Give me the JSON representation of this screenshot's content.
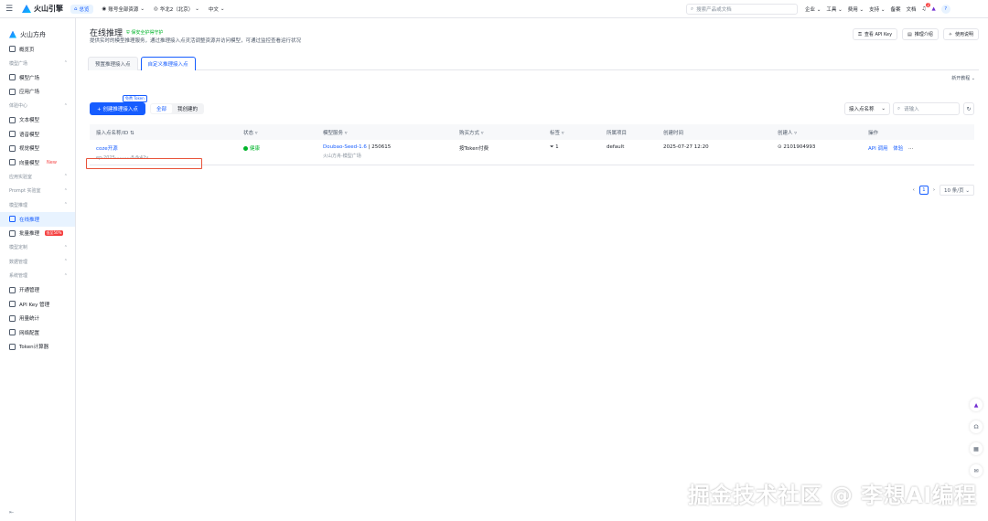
{
  "topbar": {
    "logo_text": "火山引擎",
    "home_label": "总览",
    "account_scope": "账号全部资源",
    "region": "华北2（北京）",
    "language": "中文",
    "search_placeholder": "搜索产品或文档",
    "links": [
      "企业",
      "工具",
      "费用",
      "支持",
      "备案",
      "文档"
    ],
    "notification_count": "2",
    "user_initial": "?"
  },
  "sidebar": {
    "brand": "火山方舟",
    "items": [
      {
        "type": "item",
        "label": "概览页",
        "icon": "overview-icon"
      },
      {
        "type": "group",
        "label": "模型广场"
      },
      {
        "type": "item",
        "label": "模型广场",
        "icon": "model-square-icon"
      },
      {
        "type": "item",
        "label": "应用广场",
        "icon": "app-square-icon"
      },
      {
        "type": "group",
        "label": "体验中心"
      },
      {
        "type": "item",
        "label": "文本模型",
        "icon": "text-model-icon"
      },
      {
        "type": "item",
        "label": "语音模型",
        "icon": "voice-model-icon"
      },
      {
        "type": "item",
        "label": "视觉模型",
        "icon": "vision-model-icon"
      },
      {
        "type": "item",
        "label": "向量模型",
        "icon": "vector-model-icon",
        "tag": "New"
      },
      {
        "type": "group",
        "label": "应用实验室"
      },
      {
        "type": "group",
        "label": "Prompt 实验室"
      },
      {
        "type": "group",
        "label": "模型推理"
      },
      {
        "type": "item",
        "label": "在线推理",
        "icon": "online-inference-icon",
        "active": true
      },
      {
        "type": "item",
        "label": "批量推理",
        "icon": "batch-inference-icon",
        "tag": "低至50%"
      },
      {
        "type": "group",
        "label": "模型定制"
      },
      {
        "type": "group",
        "label": "数据管理"
      },
      {
        "type": "group",
        "label": "系统管理"
      },
      {
        "type": "item",
        "label": "开通管理",
        "icon": "activation-icon"
      },
      {
        "type": "item",
        "label": "API Key 管理",
        "icon": "key-icon"
      },
      {
        "type": "item",
        "label": "用量统计",
        "icon": "usage-icon"
      },
      {
        "type": "item",
        "label": "网络配置",
        "icon": "network-icon"
      },
      {
        "type": "item",
        "label": "Token计算器",
        "icon": "calculator-icon"
      }
    ]
  },
  "page": {
    "title": "在线推理",
    "secure_badge": "保安全护得守护",
    "description": "提供实时的模型推理服务，通过推理接入点灵活调整资源并访问模型，可通过监控查看运行状况",
    "top_buttons": [
      "查看 API Key",
      "推理介绍",
      "使用说明"
    ],
    "tabs": [
      "预置推理接入点",
      "自定义推理接入点"
    ],
    "active_tab": 1,
    "new_version": "新开教程"
  },
  "toolbar": {
    "free_tag": "免费 Token",
    "create_label": "+ 创建推理接入点",
    "segments": [
      "全部",
      "我创建的"
    ],
    "filter_select": "接入点名称",
    "filter_placeholder": "请输入"
  },
  "table": {
    "columns": [
      "接入点名称/ID",
      "状态",
      "模型服务",
      "购买方式",
      "标签",
      "所属项目",
      "创建时间",
      "创建人",
      "操作"
    ],
    "rows": [
      {
        "name": "coze开源",
        "id": "ep-2025···········8-fk42v",
        "status": "健康",
        "model": "Doubao-Seed-1.6",
        "model_version": "250615",
        "model_source": "火山方舟-模型广场",
        "billing": "按Token付费",
        "tags": "1",
        "project": "default",
        "created_at": "2025-07-27 12:20",
        "creator": "2101904993",
        "actions": [
          "API 调用",
          "体验",
          "···"
        ]
      }
    ]
  },
  "pagination": {
    "current": "1",
    "page_size": "10 条/页"
  },
  "watermark": "掘金技术社区 @ 李想AI编程"
}
